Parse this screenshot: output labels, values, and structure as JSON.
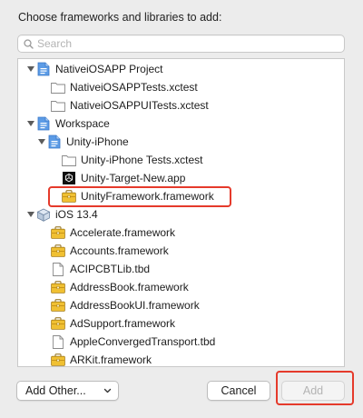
{
  "heading": "Choose frameworks and libraries to add:",
  "search": {
    "placeholder": "Search",
    "value": "",
    "icon": "search-icon"
  },
  "tree": {
    "project": {
      "label": "NativeiOSAPP Project",
      "items": [
        {
          "label": "NativeiOSAPPTests.xctest",
          "icon": "folder-icon"
        },
        {
          "label": "NativeiOSAPPUITests.xctest",
          "icon": "folder-icon"
        }
      ]
    },
    "workspace": {
      "label": "Workspace",
      "unity": {
        "label": "Unity-iPhone",
        "items": [
          {
            "label": "Unity-iPhone Tests.xctest",
            "icon": "folder-icon"
          },
          {
            "label": "Unity-Target-New.app",
            "icon": "unity-app-icon"
          },
          {
            "label": "UnityFramework.framework",
            "icon": "framework-icon"
          }
        ]
      }
    },
    "sdk": {
      "label": "iOS 13.4",
      "items": [
        {
          "label": "Accelerate.framework",
          "icon": "framework-icon"
        },
        {
          "label": "Accounts.framework",
          "icon": "framework-icon"
        },
        {
          "label": "ACIPCBTLib.tbd",
          "icon": "document-icon"
        },
        {
          "label": "AddressBook.framework",
          "icon": "framework-icon"
        },
        {
          "label": "AddressBookUI.framework",
          "icon": "framework-icon"
        },
        {
          "label": "AdSupport.framework",
          "icon": "framework-icon"
        },
        {
          "label": "AppleConvergedTransport.tbd",
          "icon": "document-icon"
        },
        {
          "label": "ARKit.framework",
          "icon": "framework-icon"
        }
      ]
    }
  },
  "buttons": {
    "add_other": "Add Other...",
    "cancel": "Cancel",
    "add": "Add"
  },
  "colors": {
    "highlight": "#e53a2b",
    "project_icon": "#4a90e2",
    "framework_icon": "#e6b422"
  }
}
